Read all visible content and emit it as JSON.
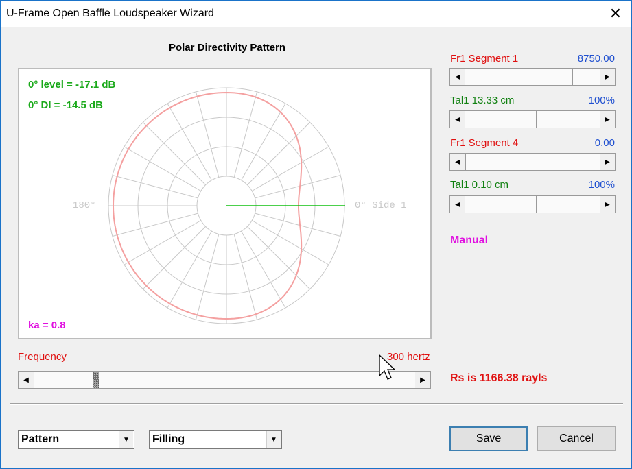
{
  "window": {
    "title": "U-Frame Open Baffle Loudspeaker Wizard"
  },
  "plot": {
    "title": "Polar Directivity Pattern",
    "level_text": "0° level = -17.1 dB",
    "di_text": "0° DI = -14.5 dB",
    "ka_text": "ka = 0.8",
    "label_180": "180°",
    "label_0": "0° Side 1"
  },
  "frequency": {
    "label": "Frequency",
    "value": "300 hertz",
    "slider_fraction": 0.16
  },
  "controls": [
    {
      "label": "Fr1  Segment 1",
      "value": "8750.00",
      "slider_fraction": 0.8
    },
    {
      "label": "Tal1  13.33 cm",
      "value": "100%",
      "slider_fraction": 0.5
    },
    {
      "label": "Fr1  Segment 4",
      "value": "0.00",
      "slider_fraction": 0.0
    },
    {
      "label": "Tal1  0.10 cm",
      "value": "100%",
      "slider_fraction": 0.5
    }
  ],
  "mode_text": "Manual",
  "rs_text": "Rs is 1166.38 rayls",
  "dropdowns": {
    "pattern": "Pattern",
    "filling": "Filling"
  },
  "buttons": {
    "save": "Save",
    "cancel": "Cancel"
  },
  "colors": {
    "accent_red": "#e01010",
    "accent_blue": "#2050d0",
    "accent_green": "#1aa91a",
    "accent_magenta": "#e010e0",
    "pattern_pink": "#f4a0a0"
  }
}
